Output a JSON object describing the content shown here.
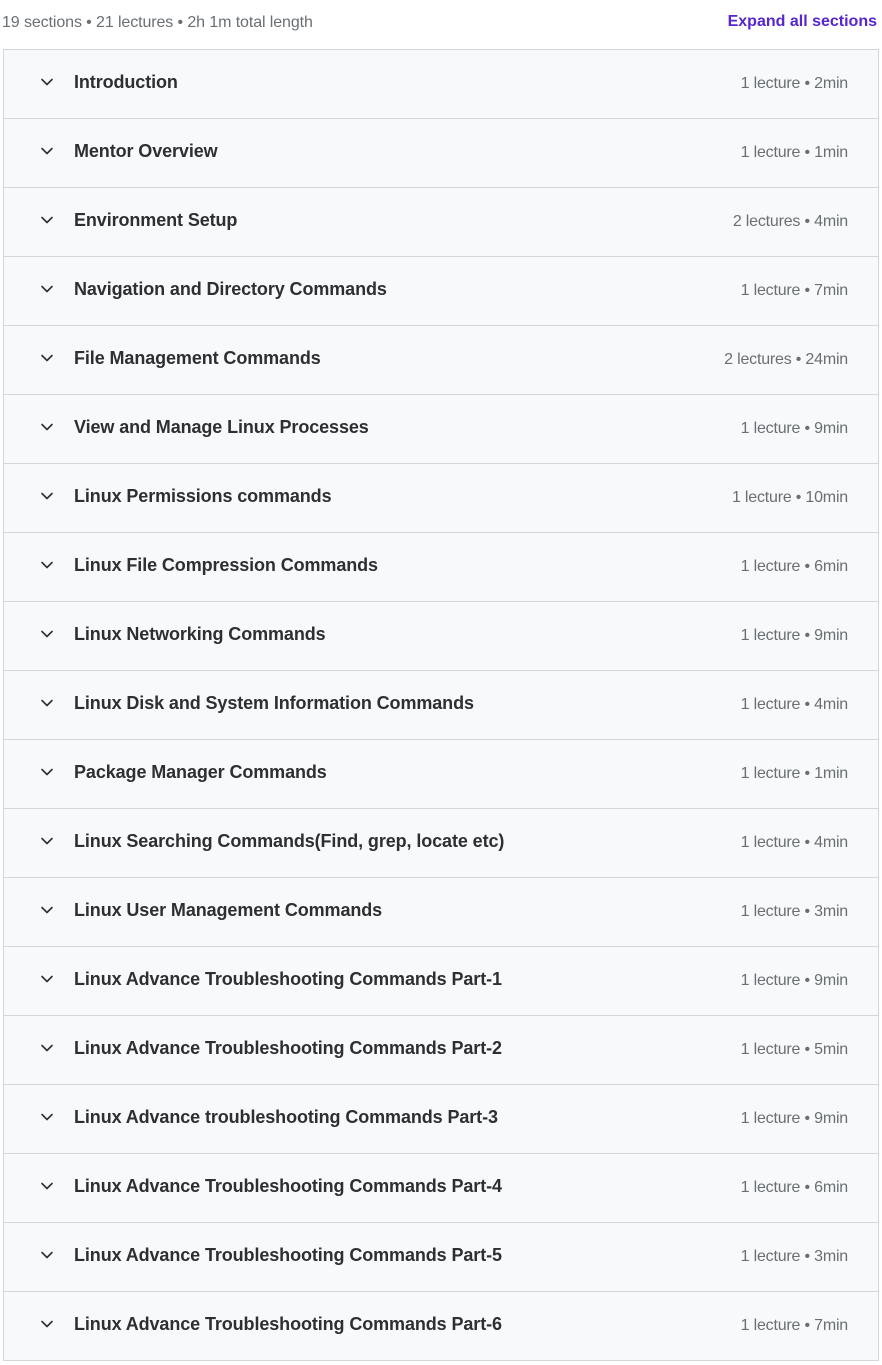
{
  "header": {
    "summary": "19 sections • 21 lectures • 2h 1m total length",
    "expand_label": "Expand all sections"
  },
  "colors": {
    "accent": "#5624d0",
    "text": "#2d2f31",
    "muted": "#6a6f73",
    "section_bg": "#f7f9fa",
    "border": "#d1d7dc"
  },
  "icons": {
    "section_toggle": "chevron-down-icon"
  },
  "sections": [
    {
      "title": "Introduction",
      "meta": "1 lecture • 2min"
    },
    {
      "title": "Mentor Overview",
      "meta": "1 lecture • 1min"
    },
    {
      "title": "Environment Setup",
      "meta": "2 lectures • 4min"
    },
    {
      "title": "Navigation and Directory Commands",
      "meta": "1 lecture • 7min"
    },
    {
      "title": "File Management Commands",
      "meta": "2 lectures • 24min"
    },
    {
      "title": "View and Manage Linux Processes",
      "meta": "1 lecture • 9min"
    },
    {
      "title": "Linux Permissions commands",
      "meta": "1 lecture • 10min"
    },
    {
      "title": "Linux File Compression Commands",
      "meta": "1 lecture • 6min"
    },
    {
      "title": "Linux Networking Commands",
      "meta": "1 lecture • 9min"
    },
    {
      "title": "Linux Disk and System Information Commands",
      "meta": "1 lecture • 4min"
    },
    {
      "title": "Package Manager Commands",
      "meta": "1 lecture • 1min"
    },
    {
      "title": "Linux Searching Commands(Find, grep, locate etc)",
      "meta": "1 lecture • 4min"
    },
    {
      "title": "Linux User Management Commands",
      "meta": "1 lecture • 3min"
    },
    {
      "title": "Linux Advance Troubleshooting Commands Part-1",
      "meta": "1 lecture • 9min"
    },
    {
      "title": "Linux Advance Troubleshooting Commands Part-2",
      "meta": "1 lecture • 5min"
    },
    {
      "title": "Linux Advance troubleshooting Commands Part-3",
      "meta": "1 lecture • 9min"
    },
    {
      "title": "Linux Advance Troubleshooting Commands Part-4",
      "meta": "1 lecture • 6min"
    },
    {
      "title": "Linux Advance Troubleshooting Commands Part-5",
      "meta": "1 lecture • 3min"
    },
    {
      "title": "Linux Advance Troubleshooting Commands Part-6",
      "meta": "1 lecture • 7min"
    }
  ]
}
